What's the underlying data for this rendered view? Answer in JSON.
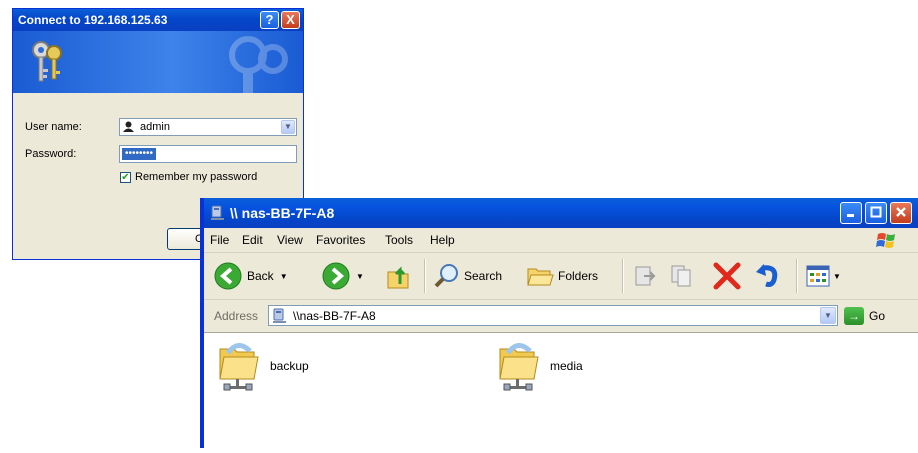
{
  "dialog": {
    "title": "Connect to 192.168.125.63",
    "help_label": "?",
    "close_label": "X",
    "username_label": "User name:",
    "username_value": "admin",
    "password_label": "Password:",
    "password_value": "••••••••",
    "remember_label": "Remember my password",
    "remember_checked": true,
    "ok_label": "OK",
    "icons": [
      "keys-icon",
      "user-icon"
    ]
  },
  "explorer": {
    "title": "\\\\ nas-BB-7F-A8",
    "menu": [
      "File",
      "Edit",
      "View",
      "Favorites",
      "Tools",
      "Help"
    ],
    "toolbar": {
      "back_label": "Back",
      "search_label": "Search",
      "folders_label": "Folders"
    },
    "address": {
      "label": "Address",
      "value": "\\\\nas-BB-7F-A8",
      "go_label": "Go"
    },
    "shares": [
      {
        "name": "backup",
        "icon": "network-folder-icon"
      },
      {
        "name": "media",
        "icon": "network-folder-icon"
      }
    ]
  },
  "colors": {
    "titlebar": "#0546c9",
    "chrome": "#ece9d8",
    "close_red": "#c13d1d",
    "accent_green": "#2a8f2a"
  }
}
